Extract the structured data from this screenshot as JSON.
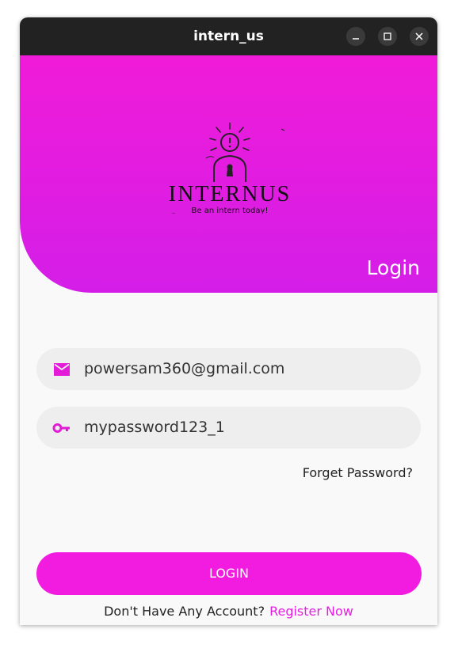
{
  "window": {
    "title": "intern_us",
    "controls": [
      "minimize-icon",
      "maximize-icon",
      "close-icon"
    ]
  },
  "header": {
    "logo_text": "INTERNUS",
    "tagline": "Be an intern today!",
    "title": "Login"
  },
  "form": {
    "email": {
      "icon": "mail-icon",
      "value": "powersam360@gmail.com"
    },
    "password": {
      "icon": "key-icon",
      "value": "mypassword123_1"
    },
    "forget_label": "Forget Password?",
    "login_label": "LOGIN",
    "no_account_text": "Don't Have Any Account?",
    "register_label": "Register Now"
  },
  "colors": {
    "accent": "#f11ce0",
    "header_gradient_top": "#f01bd8",
    "header_gradient_bottom": "#d41ee8",
    "titlebar": "#222222",
    "field_bg": "#eeeeee"
  }
}
